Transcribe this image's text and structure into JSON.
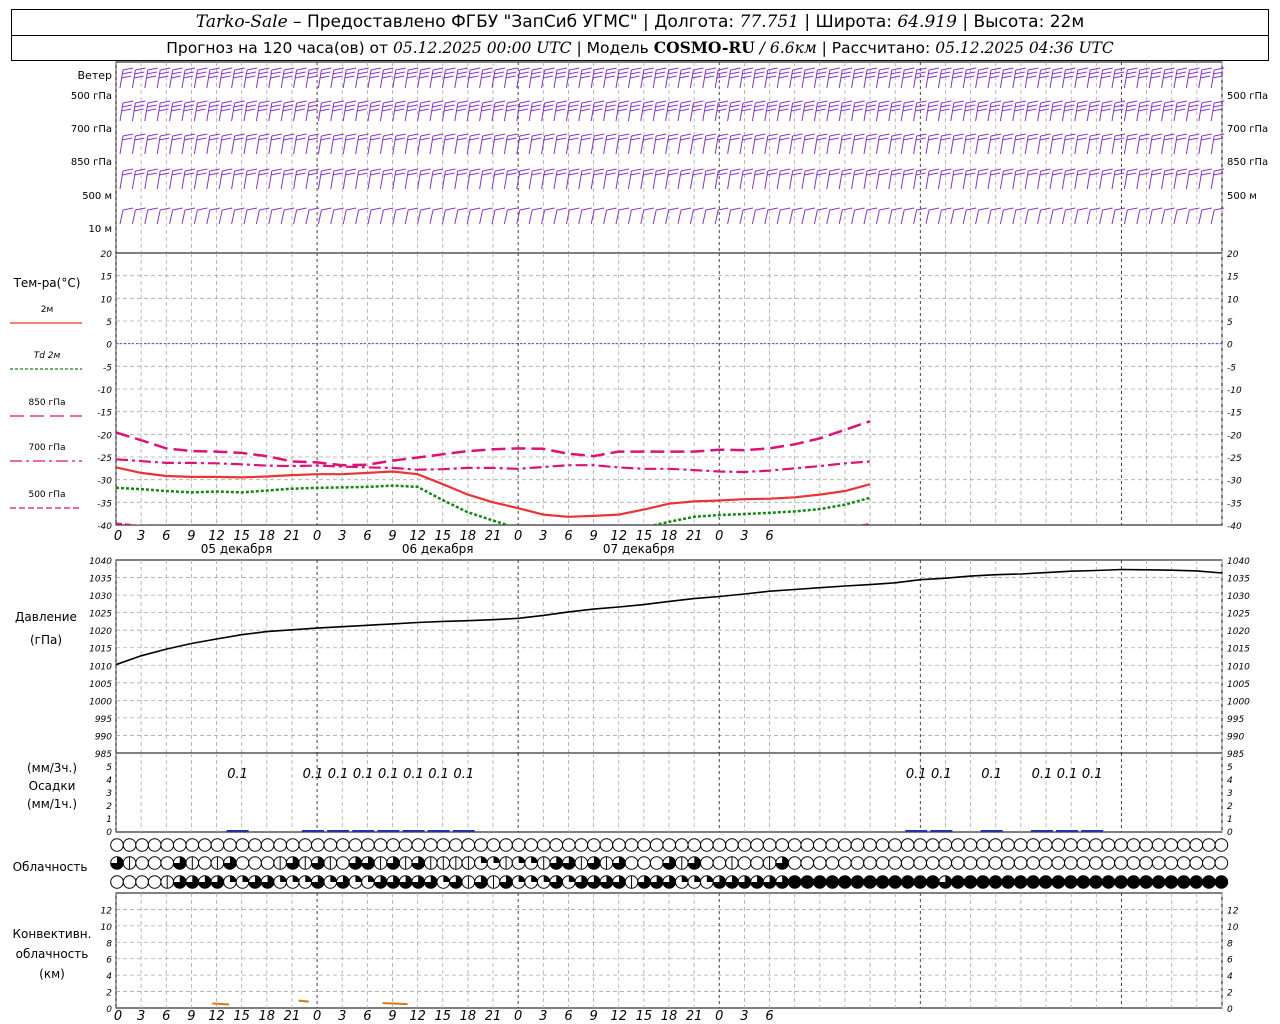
{
  "header": {
    "station": "Tarko-Sale",
    "provider": "– Предоставлено ФГБУ \"ЗапСиб УГМС\"",
    "lon_label": "| Долгота:",
    "lon_value": "77.751",
    "lat_label": "| Широта:",
    "lat_value": "64.919",
    "height_label": "| Высота:",
    "height_value": "22м",
    "forecast_label": "Прогноз на 120 часа(ов) от",
    "forecast_start": "05.12.2025 00:00 UTC",
    "model_label": "| Модель",
    "model_name": "COSMO-RU",
    "model_res": "/ 6.6км",
    "calc_label": "| Рассчитано:",
    "calc_time": "05.12.2025 04:36 UTC"
  },
  "colors": {
    "t2m": "#ee3333",
    "td2m": "#118811",
    "t850": "#dd1177",
    "t700": "#dd1177",
    "t500": "#dd1177",
    "zero_line": "#3355ff",
    "wind": "#8833cc",
    "pressure": "#000000",
    "precip": "#2233aa",
    "convective": "#dd7711"
  },
  "chart_data": {
    "x": {
      "hour_ticks": [
        "0",
        "3",
        "6",
        "9",
        "12",
        "15",
        "18",
        "21",
        "0",
        "3",
        "6",
        "9",
        "12",
        "15",
        "18",
        "21",
        "0",
        "3",
        "6",
        "9",
        "12",
        "15",
        "18",
        "21",
        "0",
        "3",
        "6"
      ],
      "day_labels": [
        "05 декабря",
        "06 декабря",
        "07 декабря"
      ]
    },
    "wind": {
      "title": "Ветер",
      "levels": [
        "500 гПа",
        "700 гПа",
        "850 гПа",
        "500 м",
        "10 м"
      ],
      "right_levels": [
        "500 гПа",
        "700 гПа",
        "850 гПа",
        "500 м"
      ]
    },
    "temperature": {
      "type": "line",
      "title": "Тем-ра(°С)",
      "ylim": [
        -40,
        20
      ],
      "yticks": [
        "20",
        "15",
        "10",
        "5",
        "0",
        "-5",
        "-10",
        "-15",
        "-20",
        "-25",
        "-30",
        "-35",
        "-40"
      ],
      "legend": [
        {
          "key": "t2m",
          "label": "2м"
        },
        {
          "key": "td2m",
          "label": "Td 2м"
        },
        {
          "key": "t850",
          "label": "850 гПа"
        },
        {
          "key": "t700",
          "label": "700 гПа"
        },
        {
          "key": "t500",
          "label": "500 гПа"
        }
      ],
      "series": [
        {
          "key": "t2m",
          "points": [
            [
              0,
              -27.3
            ],
            [
              3,
              -28.5
            ],
            [
              6,
              -29.2
            ],
            [
              9,
              -29.4
            ],
            [
              12,
              -29.4
            ],
            [
              15,
              -29.5
            ],
            [
              18,
              -29.3
            ],
            [
              21,
              -29.0
            ],
            [
              24,
              -28.8
            ],
            [
              27,
              -28.8
            ],
            [
              30,
              -28.5
            ],
            [
              33,
              -28.2
            ],
            [
              36,
              -28.8
            ],
            [
              39,
              -31.0
            ],
            [
              42,
              -33.3
            ],
            [
              45,
              -35.0
            ],
            [
              48,
              -36.3
            ],
            [
              51,
              -37.7
            ],
            [
              54,
              -38.2
            ],
            [
              57,
              -38.0
            ],
            [
              60,
              -37.7
            ],
            [
              63,
              -36.6
            ],
            [
              66,
              -35.3
            ],
            [
              69,
              -34.8
            ],
            [
              72,
              -34.6
            ],
            [
              75,
              -34.3
            ],
            [
              78,
              -34.2
            ],
            [
              81,
              -33.9
            ],
            [
              84,
              -33.3
            ],
            [
              87,
              -32.5
            ],
            [
              90,
              -31.0
            ]
          ]
        },
        {
          "key": "td2m",
          "points": [
            [
              0,
              -31.8
            ],
            [
              3,
              -32.1
            ],
            [
              6,
              -32.5
            ],
            [
              9,
              -32.8
            ],
            [
              12,
              -32.6
            ],
            [
              15,
              -32.8
            ],
            [
              18,
              -32.4
            ],
            [
              21,
              -32.0
            ],
            [
              24,
              -31.8
            ],
            [
              27,
              -31.7
            ],
            [
              30,
              -31.6
            ],
            [
              33,
              -31.3
            ],
            [
              36,
              -31.6
            ],
            [
              39,
              -34.5
            ],
            [
              42,
              -37.2
            ],
            [
              45,
              -39.0
            ],
            [
              48,
              -40.8
            ],
            [
              51,
              -42.5
            ],
            [
              54,
              -43.5
            ],
            [
              57,
              -43.0
            ],
            [
              60,
              -42.0
            ],
            [
              63,
              -40.6
            ],
            [
              66,
              -39.3
            ],
            [
              69,
              -38.2
            ],
            [
              72,
              -37.8
            ],
            [
              75,
              -37.6
            ],
            [
              78,
              -37.3
            ],
            [
              81,
              -37.0
            ],
            [
              84,
              -36.5
            ],
            [
              87,
              -35.5
            ],
            [
              90,
              -34.0
            ]
          ]
        },
        {
          "key": "t850",
          "points": [
            [
              0,
              -19.6
            ],
            [
              3,
              -21.3
            ],
            [
              6,
              -23.1
            ],
            [
              9,
              -23.7
            ],
            [
              12,
              -23.8
            ],
            [
              15,
              -24.1
            ],
            [
              18,
              -24.8
            ],
            [
              21,
              -26.0
            ],
            [
              24,
              -26.2
            ],
            [
              27,
              -26.8
            ],
            [
              30,
              -26.7
            ],
            [
              33,
              -25.8
            ],
            [
              36,
              -25.1
            ],
            [
              39,
              -24.4
            ],
            [
              42,
              -23.7
            ],
            [
              45,
              -23.3
            ],
            [
              48,
              -23.1
            ],
            [
              51,
              -23.2
            ],
            [
              54,
              -24.3
            ],
            [
              57,
              -24.8
            ],
            [
              60,
              -23.8
            ],
            [
              63,
              -23.8
            ],
            [
              66,
              -23.8
            ],
            [
              69,
              -23.8
            ],
            [
              72,
              -23.4
            ],
            [
              75,
              -23.5
            ],
            [
              78,
              -23.1
            ],
            [
              81,
              -22.2
            ],
            [
              84,
              -20.9
            ],
            [
              87,
              -19.0
            ],
            [
              90,
              -17.1
            ]
          ]
        },
        {
          "key": "t700",
          "points": [
            [
              0,
              -25.5
            ],
            [
              3,
              -25.9
            ],
            [
              6,
              -26.3
            ],
            [
              9,
              -26.3
            ],
            [
              12,
              -26.4
            ],
            [
              15,
              -26.6
            ],
            [
              18,
              -26.9
            ],
            [
              21,
              -27.0
            ],
            [
              24,
              -26.9
            ],
            [
              27,
              -27.1
            ],
            [
              30,
              -27.3
            ],
            [
              33,
              -27.4
            ],
            [
              36,
              -27.8
            ],
            [
              39,
              -27.7
            ],
            [
              42,
              -27.4
            ],
            [
              45,
              -27.4
            ],
            [
              48,
              -27.6
            ],
            [
              51,
              -27.2
            ],
            [
              54,
              -26.8
            ],
            [
              57,
              -26.8
            ],
            [
              60,
              -27.3
            ],
            [
              63,
              -27.6
            ],
            [
              66,
              -27.6
            ],
            [
              69,
              -27.9
            ],
            [
              72,
              -28.2
            ],
            [
              75,
              -28.3
            ],
            [
              78,
              -28.0
            ],
            [
              81,
              -27.5
            ],
            [
              84,
              -27.0
            ],
            [
              87,
              -26.4
            ],
            [
              90,
              -26.0
            ]
          ]
        },
        {
          "key": "t500",
          "points": [
            [
              0,
              -39.7
            ],
            [
              3,
              -40.2
            ],
            [
              84,
              -41.0
            ],
            [
              87,
              -40.6
            ],
            [
              90,
              -39.8
            ]
          ]
        }
      ]
    },
    "pressure": {
      "type": "line",
      "title": "Давление",
      "unit": "(гПа)",
      "ylim": [
        985,
        1040
      ],
      "yticks": [
        "1040",
        "1035",
        "1030",
        "1025",
        "1020",
        "1015",
        "1010",
        "1005",
        "1000",
        "995",
        "990",
        "985"
      ],
      "points": [
        [
          0,
          1010.2
        ],
        [
          3,
          1012.7
        ],
        [
          6,
          1014.6
        ],
        [
          9,
          1016.2
        ],
        [
          12,
          1017.5
        ],
        [
          15,
          1018.7
        ],
        [
          18,
          1019.6
        ],
        [
          21,
          1020.1
        ],
        [
          24,
          1020.6
        ],
        [
          27,
          1021.0
        ],
        [
          30,
          1021.4
        ],
        [
          33,
          1021.8
        ],
        [
          36,
          1022.2
        ],
        [
          39,
          1022.5
        ],
        [
          42,
          1022.7
        ],
        [
          45,
          1023.0
        ],
        [
          48,
          1023.4
        ],
        [
          51,
          1024.2
        ],
        [
          54,
          1025.2
        ],
        [
          57,
          1026.0
        ],
        [
          60,
          1026.6
        ],
        [
          63,
          1027.3
        ],
        [
          66,
          1028.2
        ],
        [
          69,
          1029.0
        ],
        [
          72,
          1029.6
        ],
        [
          75,
          1030.3
        ],
        [
          78,
          1031.1
        ],
        [
          81,
          1031.6
        ],
        [
          84,
          1032.1
        ],
        [
          87,
          1032.6
        ],
        [
          90,
          1033.0
        ],
        [
          93,
          1033.5
        ],
        [
          96,
          1034.4
        ],
        [
          99,
          1034.8
        ],
        [
          102,
          1035.4
        ],
        [
          105,
          1035.8
        ],
        [
          108,
          1036.0
        ],
        [
          111,
          1036.4
        ],
        [
          114,
          1036.8
        ],
        [
          117,
          1037.0
        ],
        [
          120,
          1037.3
        ],
        [
          123,
          1037.2
        ],
        [
          126,
          1037.1
        ],
        [
          129,
          1036.9
        ],
        [
          132,
          1036.3
        ]
      ]
    },
    "precip": {
      "type": "bar",
      "title": "Осадки",
      "unit3h": "(мм/3ч.)",
      "unit1h": "(мм/1ч.)",
      "ylim": [
        0,
        5
      ],
      "yticks": [
        "5",
        "4",
        "3",
        "2",
        "1",
        "0"
      ],
      "labels": [
        {
          "x": 12,
          "text": "0.1"
        },
        {
          "x": 21,
          "text": "0.1"
        },
        {
          "x": 24,
          "text": "0.1"
        },
        {
          "x": 27,
          "text": "0.1"
        },
        {
          "x": 30,
          "text": "0.1"
        },
        {
          "x": 33,
          "text": "0.1"
        },
        {
          "x": 36,
          "text": "0.1"
        },
        {
          "x": 39,
          "text": "0.1"
        },
        {
          "x": 93,
          "text": "0.1"
        },
        {
          "x": 96,
          "text": "0.1"
        },
        {
          "x": 102,
          "text": "0.1"
        },
        {
          "x": 108,
          "text": "0.1"
        },
        {
          "x": 111,
          "text": "0.1"
        },
        {
          "x": 114,
          "text": "0.1"
        }
      ]
    },
    "cloud": {
      "title": "Облачность",
      "rows": [
        "00000000000000000000000000000000000000000000000000000000000000000000000000000000000000000000000000000000000000000000000000000000000000000000000",
        "31000310130001313103313131111221221331313000313001001300000000000000000000000000000000000000000000000000000000000000000000000000000000000000000",
        "00001333322332223232233333231313222323333133322233333344444444444434444444444444444444444444444444444444444444444444444444444444444444444444444"
      ]
    },
    "convective": {
      "title1": "Конвективн.",
      "title2": "облачность",
      "unit": "(км)",
      "ylim": [
        0,
        14
      ],
      "yticks": [
        "12",
        "10",
        "8",
        "6",
        "4",
        "2",
        "0"
      ],
      "segments": [
        [
          11.5,
          13.5,
          0.55
        ],
        [
          21.8,
          23.0,
          0.9
        ],
        [
          31.8,
          34.8,
          0.6
        ]
      ]
    }
  }
}
